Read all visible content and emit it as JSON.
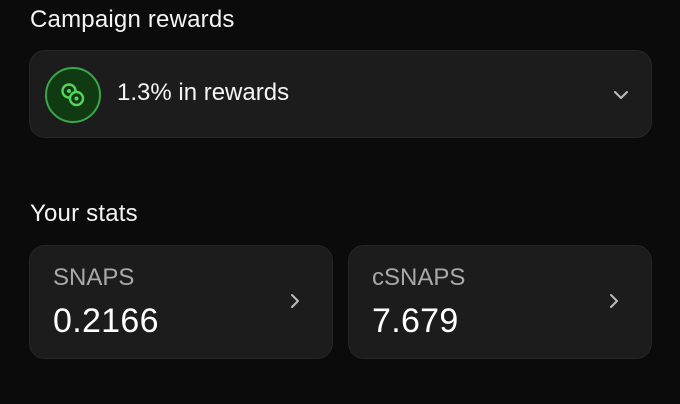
{
  "campaign": {
    "section_title": "Campaign rewards",
    "rewards_text": "1.3% in rewards",
    "icon": "coins-icon",
    "accent_color": "#3aa64a"
  },
  "stats": {
    "section_title": "Your stats",
    "cards": [
      {
        "label": "SNAPS",
        "value": "0.2166"
      },
      {
        "label": "cSNAPS",
        "value": "7.679"
      }
    ]
  }
}
